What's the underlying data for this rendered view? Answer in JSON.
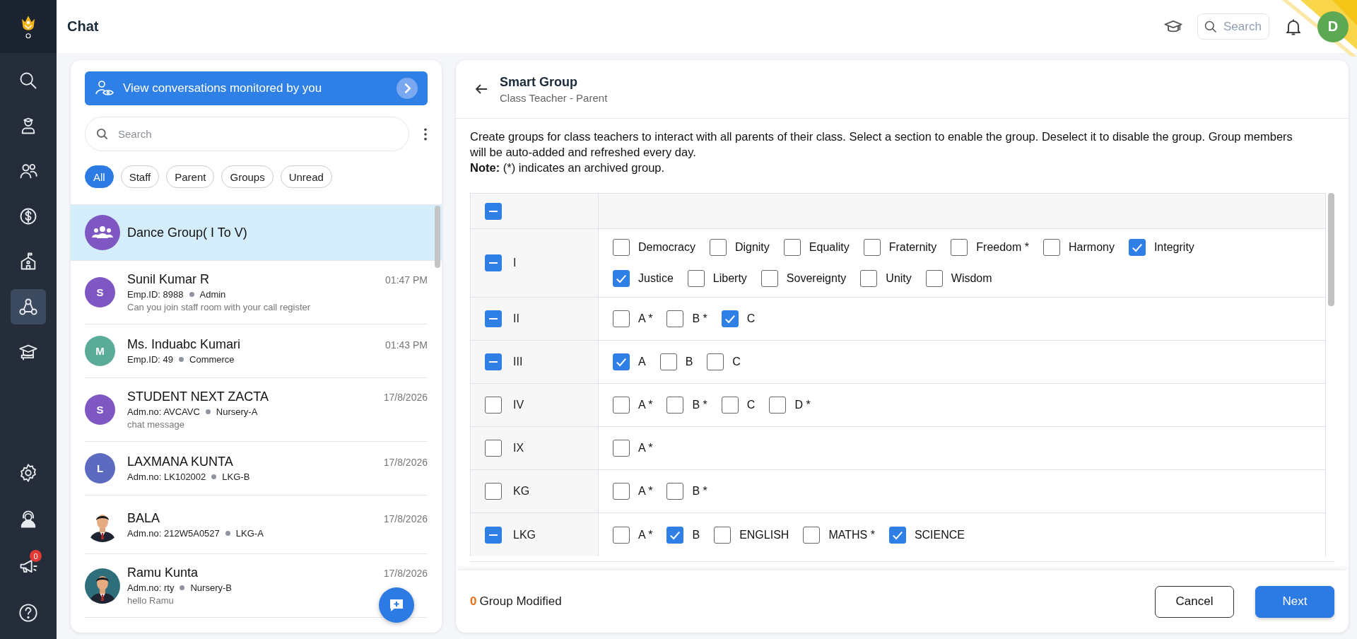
{
  "sidebar": {
    "items": [
      {
        "selected": false
      },
      {
        "selected": false
      },
      {
        "selected": false
      },
      {
        "selected": false
      },
      {
        "selected": false
      },
      {
        "selected": true
      },
      {
        "selected": false
      },
      {
        "selected": false
      },
      {
        "selected": false
      },
      {
        "selected": false,
        "badge": "0"
      },
      {
        "selected": false
      }
    ]
  },
  "header": {
    "title": "Chat",
    "search": {
      "placeholder": "Search"
    },
    "avatar": "D"
  },
  "chat_panel": {
    "monitor_button": "View conversations monitored by you",
    "search": {
      "placeholder": "Search"
    },
    "filters": [
      {
        "label": "All",
        "selected": true
      },
      {
        "label": "Staff",
        "selected": false
      },
      {
        "label": "Parent",
        "selected": false
      },
      {
        "label": "Groups",
        "selected": false
      },
      {
        "label": "Unread",
        "selected": false
      }
    ],
    "chats": [
      {
        "name": "Dance Group( I To V)",
        "selected": true,
        "avatar": {
          "kind": "group",
          "color": "#7e57c2"
        }
      },
      {
        "name": "Sunil Kumar R",
        "time": "01:47 PM",
        "id": "Emp.ID: 8988",
        "tag": "Admin",
        "message": "Can you join staff room with your call register",
        "selected": false,
        "avatar": {
          "kind": "letter",
          "letter": "S",
          "color": "#7e57c2"
        }
      },
      {
        "name": "Ms. Induabc Kumari",
        "time": "01:43 PM",
        "id": "Emp.ID: 49",
        "tag": "Commerce",
        "selected": false,
        "avatar": {
          "kind": "letter",
          "letter": "M",
          "color": "#5aab98"
        }
      },
      {
        "name": "STUDENT NEXT ZACTA",
        "time": "17/8/2026",
        "id": "Adm.no: AVCAVC",
        "tag": "Nursery-A",
        "message": "chat message",
        "selected": false,
        "avatar": {
          "kind": "letter",
          "letter": "S",
          "color": "#7e57c2"
        }
      },
      {
        "name": "LAXMANA KUNTA",
        "time": "17/8/2026",
        "id": "Adm.no: LK102002",
        "tag": "LKG-B",
        "selected": false,
        "avatar": {
          "kind": "letter",
          "letter": "L",
          "color": "#5c6bc0"
        }
      },
      {
        "name": "BALA",
        "time": "17/8/2026",
        "id": "Adm.no: 212W5A0527",
        "tag": "LKG-A",
        "selected": false
      },
      {
        "name": "Ramu Kunta",
        "time": "17/8/2026",
        "id": "Adm.no: rty",
        "tag": "Nursery-B",
        "message": "hello Ramu",
        "selected": false
      }
    ]
  },
  "smart_group": {
    "title": "Smart Group",
    "subtitle": "Class Teacher - Parent",
    "description": "Create groups for class teachers to interact with all parents of their class. Select a section to enable the group. Deselect it to disable the group. Group members will be auto-added and refreshed every day.",
    "note": "**Note:** (*) indicates an archived group.",
    "header_checkbox": {
      "indeterminate": true
    },
    "rows": [
      {
        "class": "I",
        "indeterminate": true,
        "sections": [
          {
            "label": "Democracy",
            "checked": false
          },
          {
            "label": "Dignity",
            "checked": false
          },
          {
            "label": "Equality",
            "checked": false
          },
          {
            "label": "Fraternity",
            "checked": false
          },
          {
            "label": "Freedom *",
            "checked": false
          },
          {
            "label": "Harmony",
            "checked": false
          },
          {
            "label": "Integrity",
            "checked": true
          },
          {
            "label": "Justice",
            "checked": true
          },
          {
            "label": "Liberty",
            "checked": false
          },
          {
            "label": "Sovereignty",
            "checked": false
          },
          {
            "label": "Unity",
            "checked": false
          },
          {
            "label": "Wisdom",
            "checked": false
          }
        ]
      },
      {
        "class": "II",
        "indeterminate": true,
        "sections": [
          {
            "label": "A *",
            "checked": false
          },
          {
            "label": "B *",
            "checked": false
          },
          {
            "label": "C",
            "checked": true
          }
        ]
      },
      {
        "class": "III",
        "indeterminate": true,
        "sections": [
          {
            "label": "A",
            "checked": true
          },
          {
            "label": "B",
            "checked": false
          },
          {
            "label": "C",
            "checked": false
          }
        ]
      },
      {
        "class": "IV",
        "indeterminate": false,
        "sections": [
          {
            "label": "A *",
            "checked": false
          },
          {
            "label": "B *",
            "checked": false
          },
          {
            "label": "C",
            "checked": false
          },
          {
            "label": "D *",
            "checked": false
          }
        ]
      },
      {
        "class": "IX",
        "indeterminate": false,
        "sections": [
          {
            "label": "A *",
            "checked": false
          }
        ]
      },
      {
        "class": "KG",
        "indeterminate": false,
        "sections": [
          {
            "label": "A *",
            "checked": false
          },
          {
            "label": "B *",
            "checked": false
          }
        ]
      },
      {
        "class": "LKG",
        "indeterminate": true,
        "sections": [
          {
            "label": "A *",
            "checked": false
          },
          {
            "label": "B",
            "checked": true
          },
          {
            "label": "ENGLISH",
            "checked": false
          },
          {
            "label": "MATHS *",
            "checked": false
          },
          {
            "label": "SCIENCE",
            "checked": true
          }
        ]
      }
    ],
    "modified_count": "0",
    "modified_label": "Group Modified",
    "buttons": [
      "Cancel",
      "Next"
    ]
  }
}
